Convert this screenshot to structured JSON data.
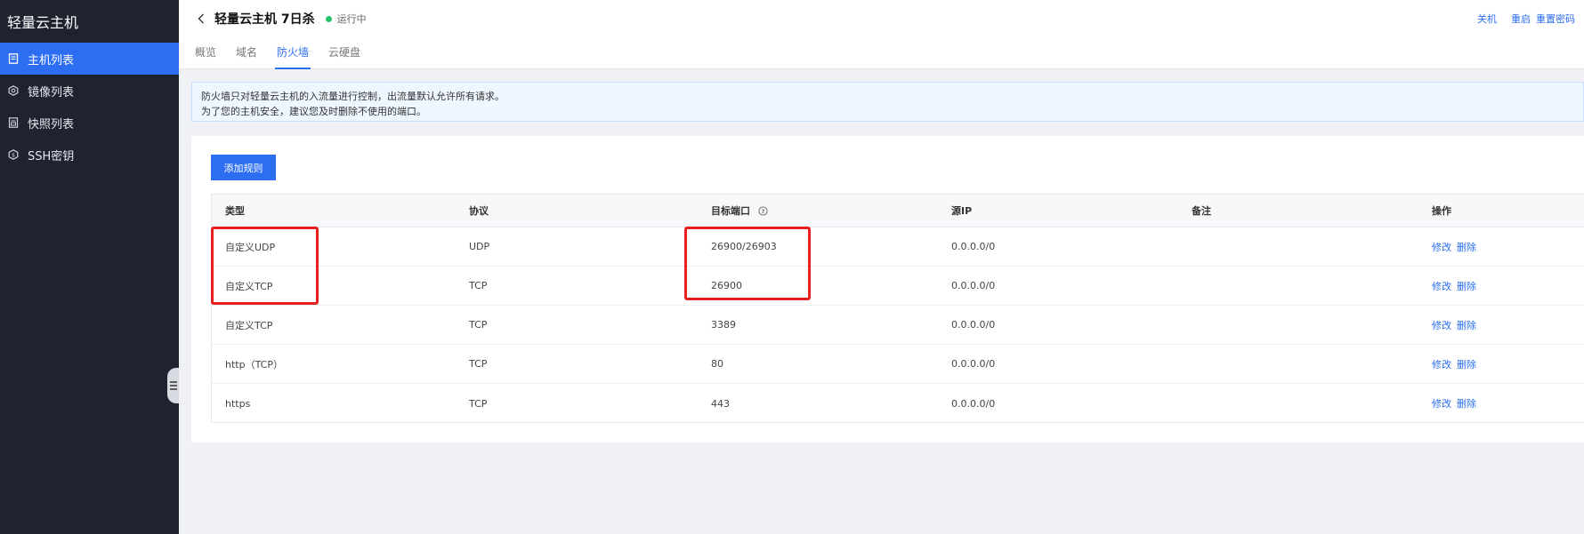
{
  "sidebar": {
    "brand": "轻量云主机",
    "items": [
      {
        "label": "主机列表",
        "icon": "document-icon",
        "active": true
      },
      {
        "label": "镜像列表",
        "icon": "hexagon-icon",
        "active": false
      },
      {
        "label": "快照列表",
        "icon": "camera-icon",
        "active": false
      },
      {
        "label": "SSH密钥",
        "icon": "key-icon",
        "active": false
      }
    ]
  },
  "header": {
    "title": "轻量云主机 7日杀",
    "status": "运行中",
    "status_color": "#29c26a",
    "actions": [
      "关机",
      "重启",
      "重置密码"
    ]
  },
  "tabs": [
    {
      "label": "概览",
      "active": false
    },
    {
      "label": "域名",
      "active": false
    },
    {
      "label": "防火墙",
      "active": true
    },
    {
      "label": "云硬盘",
      "active": false
    }
  ],
  "notice": {
    "line1": "防火墙只对轻量云主机的入流量进行控制，出流量默认允许所有请求。",
    "line2": "为了您的主机安全，建议您及时删除不使用的端口。"
  },
  "firewall": {
    "add_button": "添加规则",
    "columns": {
      "type": "类型",
      "protocol": "协议",
      "port": "目标端口",
      "source": "源IP",
      "remark": "备注",
      "action": "操作"
    },
    "rows": [
      {
        "type": "自定义UDP",
        "protocol": "UDP",
        "port": "26900/26903",
        "source": "0.0.0.0/0",
        "remark": "",
        "edit": "修改",
        "delete": "删除"
      },
      {
        "type": "自定义TCP",
        "protocol": "TCP",
        "port": "26900",
        "source": "0.0.0.0/0",
        "remark": "",
        "edit": "修改",
        "delete": "删除"
      },
      {
        "type": "自定义TCP",
        "protocol": "TCP",
        "port": "3389",
        "source": "0.0.0.0/0",
        "remark": "",
        "edit": "修改",
        "delete": "删除"
      },
      {
        "type": "http（TCP）",
        "protocol": "TCP",
        "port": "80",
        "source": "0.0.0.0/0",
        "remark": "",
        "edit": "修改",
        "delete": "删除"
      },
      {
        "type": "https",
        "protocol": "TCP",
        "port": "443",
        "source": "0.0.0.0/0",
        "remark": "",
        "edit": "修改",
        "delete": "删除"
      }
    ]
  },
  "colors": {
    "accent": "#2c6df2",
    "sidebar_bg": "#1f2330",
    "annotation": "#e81f1f"
  }
}
